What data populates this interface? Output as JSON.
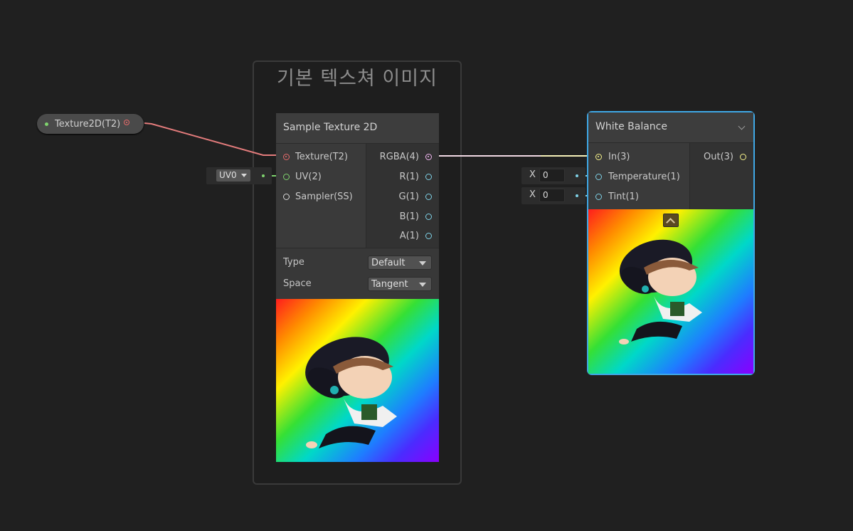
{
  "group": {
    "title": "기본 텍스쳐 이미지"
  },
  "property_node": {
    "label": "Texture2D(T2)"
  },
  "sample_texture": {
    "title": "Sample Texture 2D",
    "inputs": [
      "Texture(T2)",
      "UV(2)",
      "Sampler(SS)"
    ],
    "outputs": [
      "RGBA(4)",
      "R(1)",
      "G(1)",
      "B(1)",
      "A(1)"
    ],
    "settings": {
      "type_label": "Type",
      "type_value": "Default",
      "space_label": "Space",
      "space_value": "Tangent"
    }
  },
  "uv_field": {
    "value": "UV0"
  },
  "white_balance": {
    "title": "White Balance",
    "inputs": [
      "In(3)",
      "Temperature(1)",
      "Tint(1)"
    ],
    "outputs": [
      "Out(3)"
    ]
  },
  "temperature_field": {
    "axis": "X",
    "value": "0"
  },
  "tint_field": {
    "axis": "X",
    "value": "0"
  },
  "colors": {
    "texture_port": "#e56a6a",
    "vector2_port": "#7fd36e",
    "vector4_port": "#f2b6f2",
    "float_port": "#7ed1e6",
    "vector3_port": "#f6f28a",
    "selection": "#3fa8e6"
  }
}
